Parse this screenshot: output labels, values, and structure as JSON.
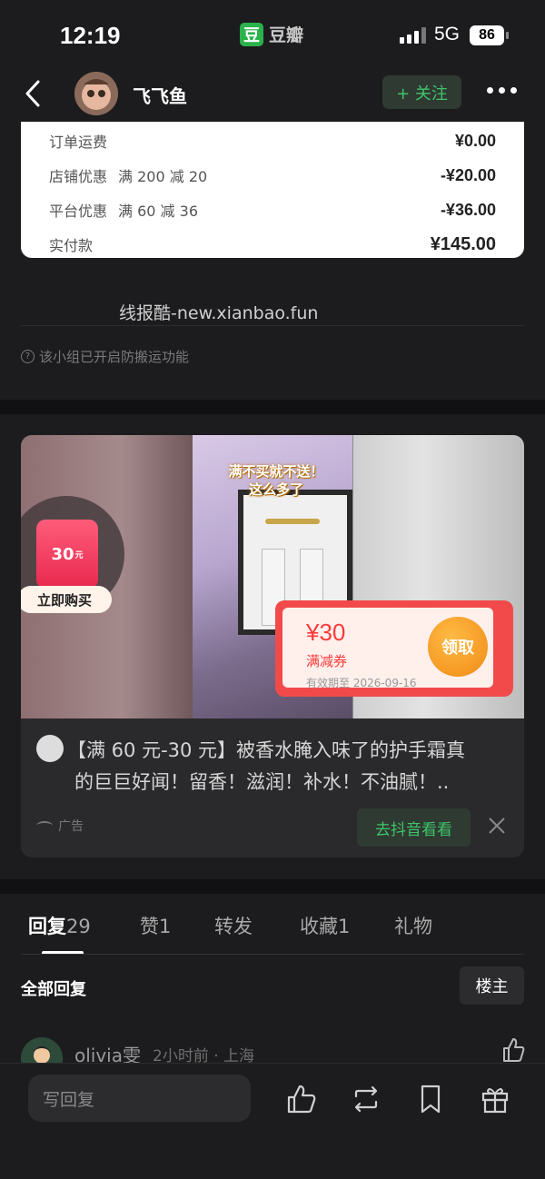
{
  "status_bar": {
    "time": "12:19",
    "app_logo": "豆",
    "app_name": "豆瓣",
    "network": "5G",
    "battery": "86"
  },
  "header": {
    "username": "飞飞鱼",
    "follow_label": "+ 关注"
  },
  "order": {
    "rows": [
      {
        "label": "订单运费",
        "sub": "",
        "value": "¥0.00"
      },
      {
        "label": "店铺优惠",
        "sub": "满 200 减 20",
        "value": "-¥20.00"
      },
      {
        "label": "平台优惠",
        "sub": "满 60 减 36",
        "value": "-¥36.00"
      },
      {
        "label": "实付款",
        "sub": "",
        "value": "¥145.00"
      }
    ]
  },
  "post": {
    "watermark": "线报酷-new.xianbao.fun",
    "notice": "该小组已开启防搬运功能"
  },
  "ad": {
    "caption": "满不买就不送！这么多了",
    "ticket_amount": "30",
    "ticket_unit": "元",
    "buy_label": "立即购买",
    "coupon_amount": "¥30",
    "coupon_type": "满减券",
    "coupon_expiry": "有效期至 2026-09-16",
    "coupon_button": "领取",
    "title_line1": "【满 60 元-30 元】被香水腌入味了的护手霜真",
    "title_line2": "的巨巨好闻！留香！滋润！补水！不油腻！..",
    "label": "广告",
    "cta": "去抖音看看"
  },
  "tabs": [
    {
      "label": "回复",
      "count": "29"
    },
    {
      "label": "赞",
      "count": "1"
    },
    {
      "label": "转发",
      "count": ""
    },
    {
      "label": "收藏",
      "count": "1"
    },
    {
      "label": "礼物",
      "count": ""
    }
  ],
  "replies": {
    "header": "全部回复",
    "op_filter": "楼主",
    "first": {
      "name": "olivia雯",
      "meta": "2小时前 · 上海"
    }
  },
  "bottom_bar": {
    "placeholder": "写回复"
  },
  "colors": {
    "accent_green": "#3fc46a",
    "coupon_red": "#f24a4a",
    "coupon_orange": "#f08a16"
  }
}
